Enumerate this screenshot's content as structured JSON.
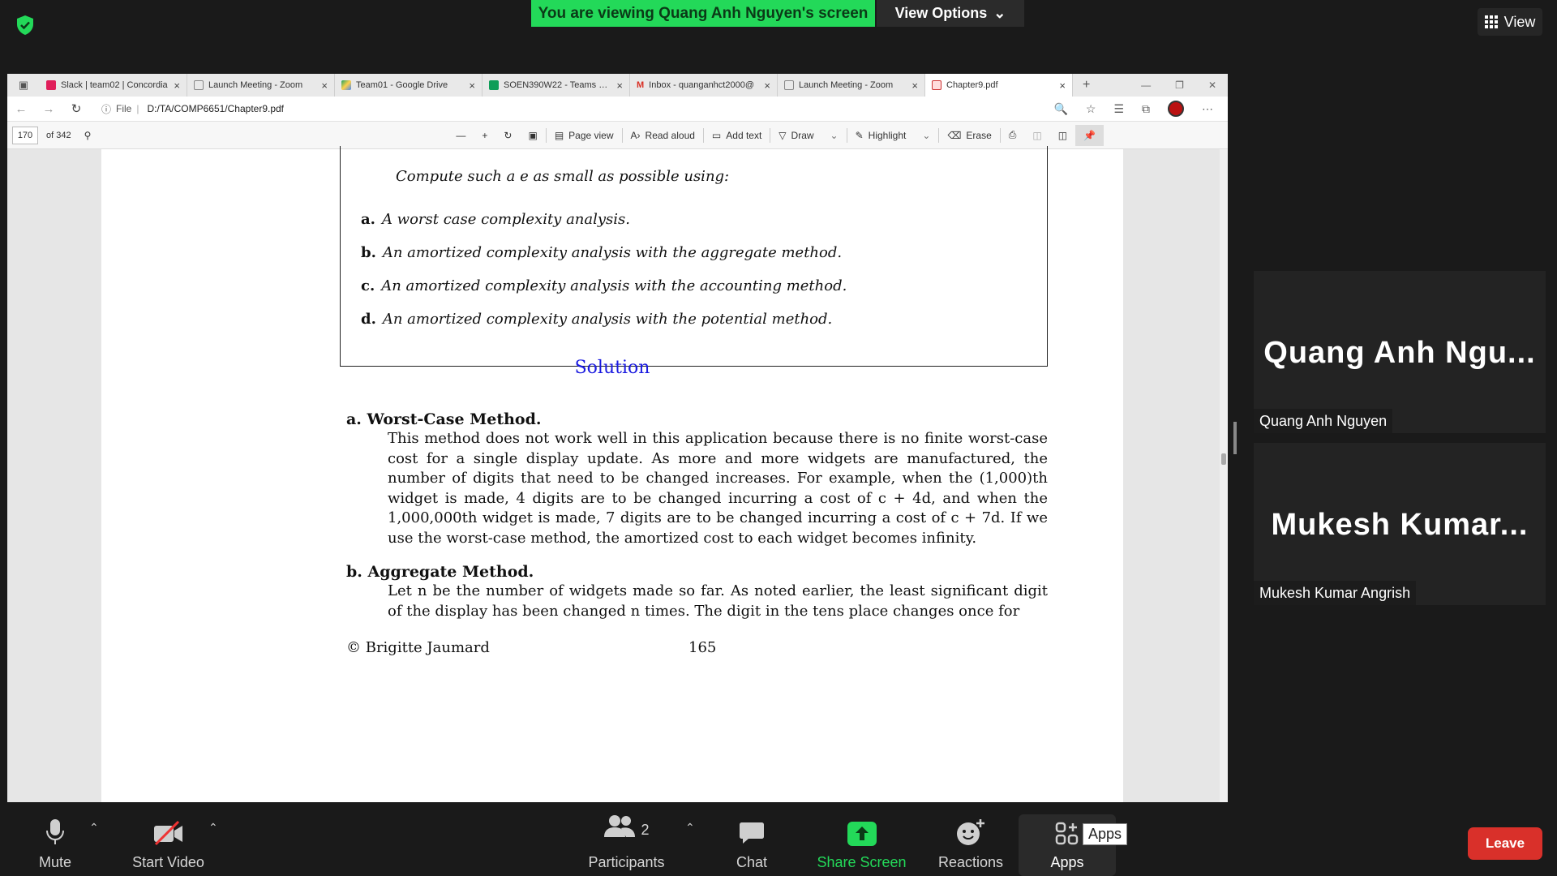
{
  "zoom": {
    "banner": "You are viewing Quang Anh Nguyen's screen",
    "view_options": "View Options",
    "view": "View",
    "accent_green": "#23d959",
    "leave_red": "#d9302a"
  },
  "browser": {
    "tabs": [
      {
        "title": "Slack | team02 | Concordia",
        "icon": "slack-icon"
      },
      {
        "title": "Launch Meeting - Zoom",
        "icon": "page-icon"
      },
      {
        "title": "Team01 - Google Drive",
        "icon": "drive-icon"
      },
      {
        "title": "SOEN390W22 - Teams with",
        "icon": "sheets-icon"
      },
      {
        "title": "Inbox - quanganhct2000@",
        "icon": "gmail-icon"
      },
      {
        "title": "Launch Meeting - Zoom",
        "icon": "page-icon"
      },
      {
        "title": "Chapter9.pdf",
        "icon": "pdf-icon"
      }
    ],
    "address": {
      "file_label": "File",
      "url": "D:/TA/COMP6651/Chapter9.pdf"
    },
    "pdf_toolbar": {
      "page": "170",
      "of_pages": "of 342",
      "page_view": "Page view",
      "read_aloud": "Read aloud",
      "add_text": "Add text",
      "draw": "Draw",
      "highlight": "Highlight",
      "erase": "Erase"
    }
  },
  "pdf": {
    "compute": "Compute such a e as small as possible using:",
    "items": [
      {
        "label": "a.",
        "text": "A worst case complexity analysis."
      },
      {
        "label": "b.",
        "text": "An amortized complexity analysis with the aggregate method."
      },
      {
        "label": "c.",
        "text": "An amortized complexity analysis with the accounting method."
      },
      {
        "label": "d.",
        "text": "An amortized complexity analysis with the potential method."
      }
    ],
    "solution": "Solution",
    "sec_a": "a. Worst-Case Method.",
    "para_a": "This method does not work well in this application because there is no finite worst-case cost for a single display update. As more and more widgets are manufactured, the number of digits that need to be changed increases. For example, when the (1,000)th widget is made, 4 digits are to be changed incurring a cost of c + 4d, and when the 1,000,000th widget is made, 7 digits are to be changed incurring a cost of c + 7d. If we use the worst-case method, the amortized cost to each widget becomes infinity.",
    "sec_b": "b. Aggregate Method.",
    "para_b": "Let n be the number of widgets made so far. As noted earlier, the least significant digit of the display has been changed n times. The digit in the tens place changes once for",
    "footer_author": "©  Brigitte Jaumard",
    "footer_page": "165"
  },
  "participants": [
    {
      "big": "Quang Anh Ngu...",
      "label": "Quang Anh Nguyen"
    },
    {
      "big": "Mukesh Kumar...",
      "label": "Mukesh Kumar Angrish"
    }
  ],
  "toolbar": {
    "mute": "Mute",
    "start_video": "Start Video",
    "participants": "Participants",
    "participants_count": "2",
    "chat": "Chat",
    "share_screen": "Share Screen",
    "reactions": "Reactions",
    "apps": "Apps",
    "apps_tooltip": "Apps",
    "leave": "Leave"
  }
}
